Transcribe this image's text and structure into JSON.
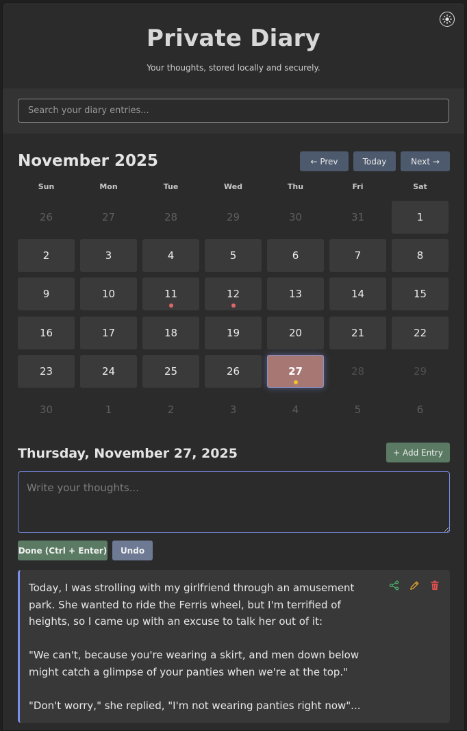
{
  "app": {
    "title": "Private Diary",
    "subtitle": "Your thoughts, stored locally and securely.",
    "theme_toggle_icon": "sun-icon"
  },
  "search": {
    "placeholder": "Search your diary entries..."
  },
  "calendar": {
    "month_title": "November 2025",
    "nav": {
      "prev": "← Prev",
      "today": "Today",
      "next": "Next →"
    },
    "weekdays": [
      "Sun",
      "Mon",
      "Tue",
      "Wed",
      "Thu",
      "Fri",
      "Sat"
    ],
    "weeks": [
      [
        {
          "d": "26",
          "t": "other"
        },
        {
          "d": "27",
          "t": "other"
        },
        {
          "d": "28",
          "t": "other"
        },
        {
          "d": "29",
          "t": "other"
        },
        {
          "d": "30",
          "t": "other"
        },
        {
          "d": "31",
          "t": "other"
        },
        {
          "d": "1",
          "t": "cur"
        }
      ],
      [
        {
          "d": "2",
          "t": "cur"
        },
        {
          "d": "3",
          "t": "cur"
        },
        {
          "d": "4",
          "t": "cur"
        },
        {
          "d": "5",
          "t": "cur"
        },
        {
          "d": "6",
          "t": "cur"
        },
        {
          "d": "7",
          "t": "cur"
        },
        {
          "d": "8",
          "t": "cur"
        }
      ],
      [
        {
          "d": "9",
          "t": "cur"
        },
        {
          "d": "10",
          "t": "cur"
        },
        {
          "d": "11",
          "t": "cur",
          "dot": "#e06666"
        },
        {
          "d": "12",
          "t": "cur",
          "dot": "#e06666"
        },
        {
          "d": "13",
          "t": "cur"
        },
        {
          "d": "14",
          "t": "cur"
        },
        {
          "d": "15",
          "t": "cur"
        }
      ],
      [
        {
          "d": "16",
          "t": "cur"
        },
        {
          "d": "17",
          "t": "cur"
        },
        {
          "d": "18",
          "t": "cur"
        },
        {
          "d": "19",
          "t": "cur"
        },
        {
          "d": "20",
          "t": "cur"
        },
        {
          "d": "21",
          "t": "cur"
        },
        {
          "d": "22",
          "t": "cur"
        }
      ],
      [
        {
          "d": "23",
          "t": "cur"
        },
        {
          "d": "24",
          "t": "cur"
        },
        {
          "d": "25",
          "t": "cur"
        },
        {
          "d": "26",
          "t": "cur"
        },
        {
          "d": "27",
          "t": "selected",
          "dot": "#f2c230"
        },
        {
          "d": "28",
          "t": "dim"
        },
        {
          "d": "29",
          "t": "dim"
        }
      ],
      [
        {
          "d": "30",
          "t": "other"
        },
        {
          "d": "1",
          "t": "other"
        },
        {
          "d": "2",
          "t": "other"
        },
        {
          "d": "3",
          "t": "other"
        },
        {
          "d": "4",
          "t": "other"
        },
        {
          "d": "5",
          "t": "other"
        },
        {
          "d": "6",
          "t": "other"
        }
      ]
    ]
  },
  "editor": {
    "date_heading": "Thursday, November 27, 2025",
    "add_entry": "+ Add Entry",
    "placeholder": "Write your thoughts...",
    "done": "Done (Ctrl + Enter)",
    "undo": "Undo"
  },
  "entries": [
    {
      "text": "Today, I was strolling with my girlfriend through an amusement park. She wanted to ride the Ferris wheel, but I'm terrified of heights, so I came up with an excuse to talk her out of it:\n\n\"We can't, because you're wearing a skirt, and men down below might catch a glimpse of your panties when we're at the top.\"\n\n\"Don't worry,\" she replied, \"I'm not wearing panties right now\"...",
      "actions": [
        "share-icon",
        "edit-icon",
        "delete-icon"
      ]
    }
  ],
  "colors": {
    "accent": "#7b8ee8",
    "selected_day": "#a77774",
    "success_button": "#5a7a63",
    "nav_button": "#4d5a6e",
    "undo_button": "#6e7a94",
    "share": "#4caf6e",
    "edit": "#e0a030",
    "delete": "#e05050"
  }
}
